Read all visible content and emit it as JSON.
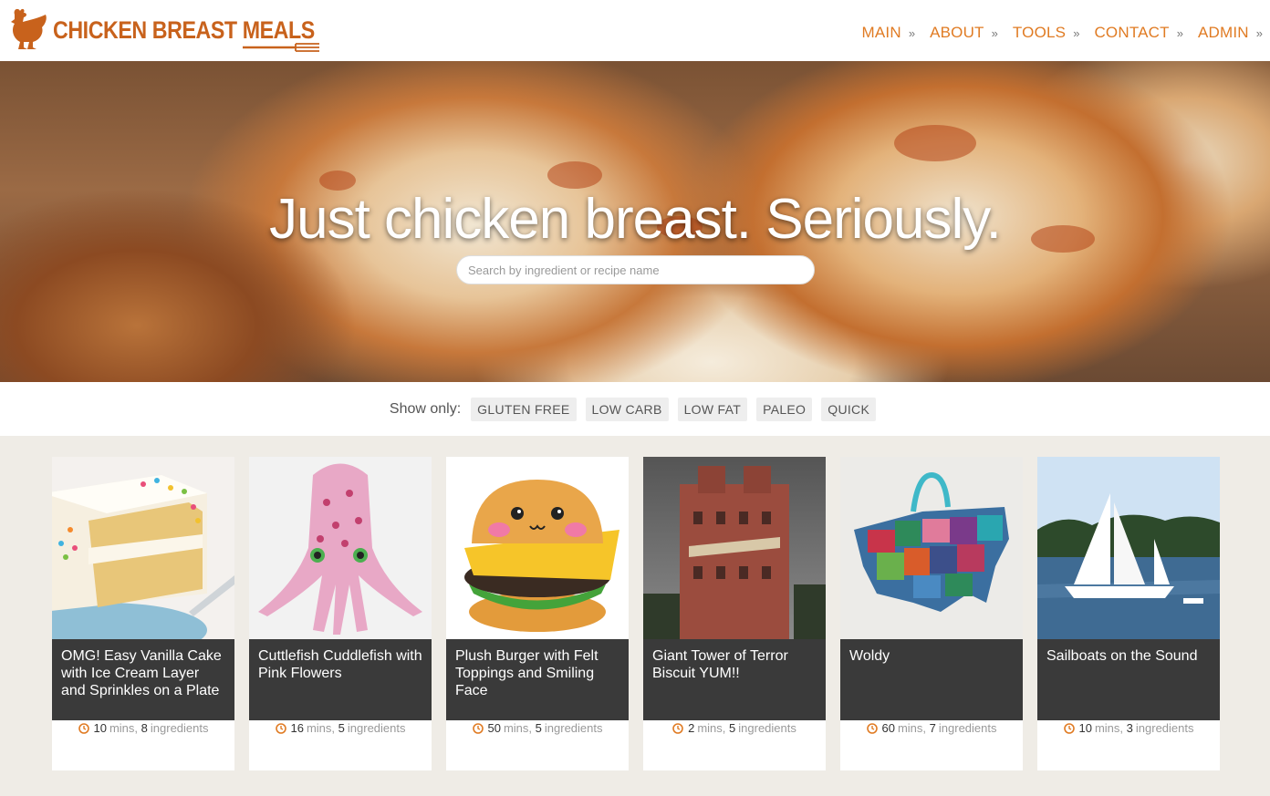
{
  "site": {
    "logo_text": "CHICKEN BREAST MEALS",
    "brand_color": "#c8621c"
  },
  "nav": {
    "items": [
      {
        "label": "MAIN",
        "sep": "»"
      },
      {
        "label": "ABOUT",
        "sep": "»"
      },
      {
        "label": "TOOLS",
        "sep": "»"
      },
      {
        "label": "CONTACT",
        "sep": "»"
      },
      {
        "label": "ADMIN",
        "sep": "»"
      }
    ]
  },
  "hero": {
    "title": "Just chicken breast. Seriously.",
    "search_placeholder": "Search by ingredient or recipe name"
  },
  "filters": {
    "label": "Show only:",
    "chips": [
      "GLUTEN FREE",
      "LOW CARB",
      "LOW FAT",
      "PALEO",
      "QUICK"
    ]
  },
  "cards": [
    {
      "title": "OMG! Easy Vanilla Cake with Ice Cream Layer and Sprinkles on a Plate",
      "mins": "10",
      "mins_label": "mins,",
      "ingredients": "8",
      "ingredients_label": "ingredients",
      "icon": "cake-image"
    },
    {
      "title": "Cuttlefish Cuddlefish with Pink Flowers",
      "mins": "16",
      "mins_label": "mins,",
      "ingredients": "5",
      "ingredients_label": "ingredients",
      "icon": "cuttlefish-plush-image"
    },
    {
      "title": "Plush Burger with Felt Toppings and Smiling Face",
      "mins": "50",
      "mins_label": "mins,",
      "ingredients": "5",
      "ingredients_label": "ingredients",
      "icon": "burger-plush-image"
    },
    {
      "title": "Giant Tower of Terror Biscuit YUM!!",
      "mins": "2",
      "mins_label": "mins,",
      "ingredients": "5",
      "ingredients_label": "ingredients",
      "icon": "tower-hotel-image"
    },
    {
      "title": "Woldy",
      "mins": "60",
      "mins_label": "mins,",
      "ingredients": "7",
      "ingredients_label": "ingredients",
      "icon": "usa-map-ornament-image"
    },
    {
      "title": "Sailboats on the Sound",
      "mins": "10",
      "mins_label": "mins,",
      "ingredients": "3",
      "ingredients_label": "ingredients",
      "icon": "sailboat-image"
    }
  ]
}
